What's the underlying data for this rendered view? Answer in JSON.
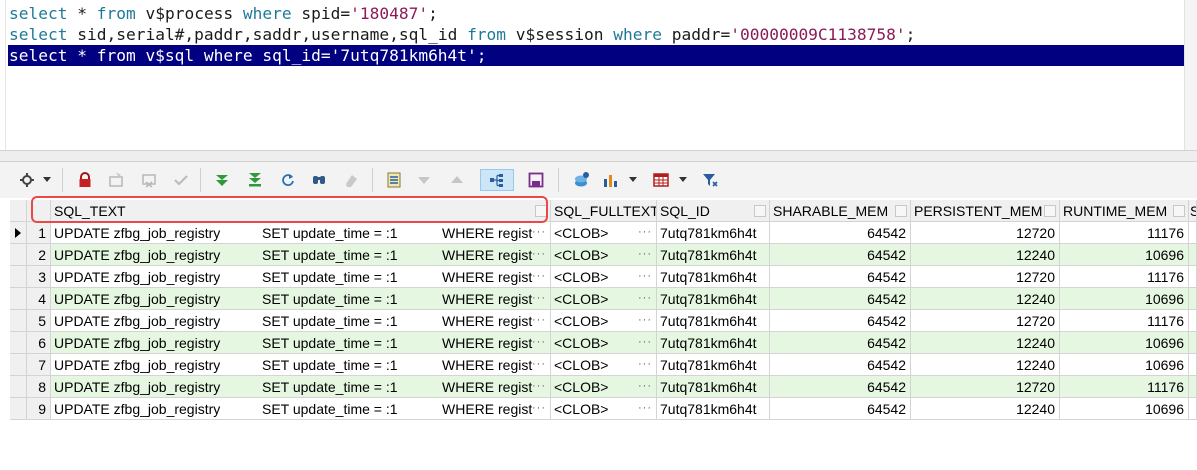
{
  "editor": {
    "line1": {
      "kw1": "select",
      "t1": " * ",
      "kw2": "from",
      "t2": " v$process ",
      "kw3": "where",
      "t3": " spid=",
      "str": "'180487'",
      "end": ";"
    },
    "line2": {
      "kw1": "select",
      "t1": " sid,serial#,paddr,saddr,username,sql_id ",
      "kw2": "from",
      "t2": " v$session ",
      "kw3": "where",
      "t3": " paddr=",
      "str": "'00000009C1138758'",
      "end": ";"
    },
    "line3": {
      "text": "select * from v$sql where sql_id='7utq781km6h4t';"
    }
  },
  "toolbar": {
    "icons": [
      "grid-options-icon",
      "lock-icon",
      "new-record-icon",
      "delete-record-icon",
      "post-changes-icon",
      "fetch-next-icon",
      "fetch-last-icon",
      "refresh-icon",
      "find-icon",
      "clear-filter-icon",
      "single-record-view-icon",
      "sort-descending-icon",
      "sort-ascending-icon",
      "query-by-example-icon",
      "save-icon",
      "export-icon",
      "chart-icon",
      "table-options-icon",
      "filter-icon"
    ]
  },
  "grid": {
    "columns": [
      "SQL_TEXT",
      "SQL_FULLTEXT",
      "SQL_ID",
      "SHARABLE_MEM",
      "PERSISTENT_MEM",
      "RUNTIME_MEM",
      "S"
    ],
    "rows": [
      {
        "n": "1",
        "a": "UPDATE zfbg_job_registry",
        "b": "SET update_time = :1",
        "c": "WHERE regist",
        "clob": "<CLOB>",
        "id": "7utq781km6h4t",
        "sm": "64542",
        "pm": "12720",
        "rm": "11176"
      },
      {
        "n": "2",
        "a": "UPDATE zfbg_job_registry",
        "b": "SET update_time = :1",
        "c": "WHERE regist",
        "clob": "<CLOB>",
        "id": "7utq781km6h4t",
        "sm": "64542",
        "pm": "12240",
        "rm": "10696"
      },
      {
        "n": "3",
        "a": "UPDATE zfbg_job_registry",
        "b": "SET update_time = :1",
        "c": "WHERE regist",
        "clob": "<CLOB>",
        "id": "7utq781km6h4t",
        "sm": "64542",
        "pm": "12720",
        "rm": "11176"
      },
      {
        "n": "4",
        "a": "UPDATE zfbg_job_registry",
        "b": "SET update_time = :1",
        "c": "WHERE regist",
        "clob": "<CLOB>",
        "id": "7utq781km6h4t",
        "sm": "64542",
        "pm": "12240",
        "rm": "10696"
      },
      {
        "n": "5",
        "a": "UPDATE zfbg_job_registry",
        "b": "SET update_time = :1",
        "c": "WHERE regist",
        "clob": "<CLOB>",
        "id": "7utq781km6h4t",
        "sm": "64542",
        "pm": "12720",
        "rm": "11176"
      },
      {
        "n": "6",
        "a": "UPDATE zfbg_job_registry",
        "b": "SET update_time = :1",
        "c": "WHERE regist",
        "clob": "<CLOB>",
        "id": "7utq781km6h4t",
        "sm": "64542",
        "pm": "12240",
        "rm": "10696"
      },
      {
        "n": "7",
        "a": "UPDATE zfbg_job_registry",
        "b": "SET update_time = :1",
        "c": "WHERE regist",
        "clob": "<CLOB>",
        "id": "7utq781km6h4t",
        "sm": "64542",
        "pm": "12240",
        "rm": "10696"
      },
      {
        "n": "8",
        "a": "UPDATE zfbg_job_registry",
        "b": "SET update_time = :1",
        "c": "WHERE regist",
        "clob": "<CLOB>",
        "id": "7utq781km6h4t",
        "sm": "64542",
        "pm": "12720",
        "rm": "11176"
      },
      {
        "n": "9",
        "a": "UPDATE zfbg_job_registry",
        "b": "SET update_time = :1",
        "c": "WHERE regist",
        "clob": "<CLOB>",
        "id": "7utq781km6h4t",
        "sm": "64542",
        "pm": "12240",
        "rm": "10696"
      }
    ]
  },
  "colors": {
    "selection": "#000080",
    "keyword": "#1f7a99",
    "string": "#8b1a56",
    "alt_row": "#e6f7e1",
    "highlight": "#e84a4a"
  }
}
